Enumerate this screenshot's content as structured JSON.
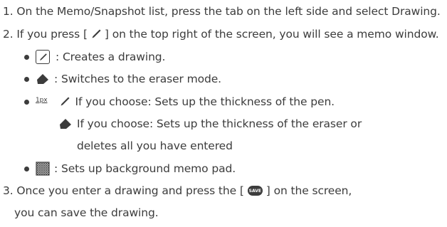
{
  "steps": {
    "step1": "1. On the Memo/Snapshot list, press the tab on the left side and select Drawing.",
    "step2_prefix": "2. If you press [",
    "step2_suffix": "] on the top right of the screen, you will see a memo window.",
    "bullet_drawing": ": Creates a drawing.",
    "bullet_eraser": ": Switches to the eraser mode.",
    "thickness_label": "1px",
    "pen_choice": "If you choose: Sets up the thickness of the pen.",
    "eraser_choice_line1": "If you choose: Sets up the thickness of the eraser or",
    "eraser_choice_line2": "deletes all you have entered",
    "bullet_background": ": Sets up background memo pad.",
    "step3_prefix": "3. Once you enter a drawing and press the [",
    "save_badge": "SAVE",
    "step3_suffix": "] on the screen,",
    "step3_line2": "you can save the drawing."
  },
  "icons": {
    "pen": "pen-icon",
    "draw_box": "draw-box-icon",
    "eraser": "eraser-icon",
    "pattern": "background-pattern-icon",
    "save": "save-icon"
  },
  "colors": {
    "text": "#3c3c3c"
  }
}
